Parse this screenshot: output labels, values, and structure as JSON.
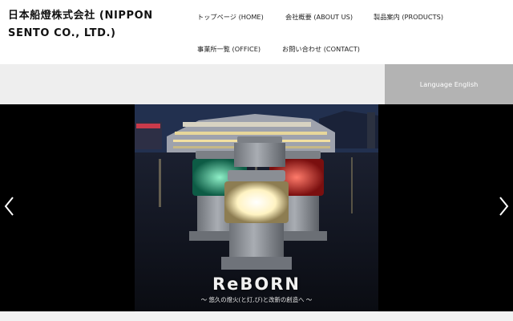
{
  "header": {
    "logo_text": "日本船燈株式会社 (NIPPON SENTO CO., LTD.)",
    "nav": {
      "home": "トップページ (HOME)",
      "about": "会社概要 (ABOUT US)",
      "products": "製品案内 (PRODUCTS)",
      "office": "事業所一覧 (OFFICE)",
      "contact": "お問い合わせ (CONTACT)"
    }
  },
  "language": {
    "label": "Language English"
  },
  "slider": {
    "headline": "ReBORN",
    "tagline": "～ 悠久の燈火(と灯,び)と改新の創造へ ～",
    "prev_icon": "chevron-left-icon",
    "next_icon": "chevron-right-icon"
  },
  "colors": {
    "band": "#eeeeee",
    "language_button": "#b3b3b3",
    "slider_background": "#000000"
  }
}
